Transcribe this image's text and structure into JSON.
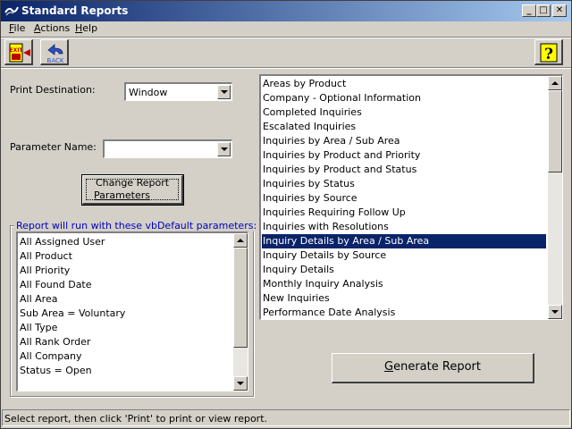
{
  "window": {
    "title": "Standard Reports",
    "minimize": "_",
    "maximize": "□",
    "close": "✕"
  },
  "menu": {
    "items": [
      {
        "u": "F",
        "rest": "ile"
      },
      {
        "u": "A",
        "rest": "ctions"
      },
      {
        "u": "H",
        "rest": "elp"
      }
    ]
  },
  "toolbar": {
    "exit_icon_text": "EXIT",
    "back_label": "BACK",
    "help_glyph": "?"
  },
  "form": {
    "print_destination_label": "Print Destination:",
    "print_destination_value": "Window",
    "parameter_name_label": "Parameter Name:",
    "parameter_name_value": "",
    "change_button_line1": "Change Report",
    "change_button_line2": "Parameters"
  },
  "parameters_group": {
    "legend": "Report will run with these vbDefault parameters:",
    "items": [
      "All Assigned User",
      "All Product",
      "All Priority",
      "All Found Date",
      "All Area",
      "Sub Area = Voluntary",
      "All Type",
      "All Rank Order",
      "All Company",
      "Status = Open"
    ]
  },
  "reports": {
    "items": [
      "Areas by Product",
      "Company - Optional Information",
      "Completed Inquiries",
      "Escalated Inquiries",
      "Inquiries by Area / Sub Area",
      "Inquiries by Product and Priority",
      "Inquiries by Product and Status",
      "Inquiries by Status",
      "Inquiries by Source",
      "Inquiries Requiring Follow Up",
      "Inquiries with Resolutions",
      "Inquiry Details by Area / Sub Area",
      "Inquiry Details by Source",
      "Inquiry Details",
      "Monthly Inquiry Analysis",
      "New Inquiries",
      "Performance Date Analysis"
    ],
    "selected": "Inquiry Details by Area / Sub Area"
  },
  "generate_button": {
    "u": "G",
    "rest": "enerate Report"
  },
  "status": "Select report, then click 'Print' to print or view report."
}
